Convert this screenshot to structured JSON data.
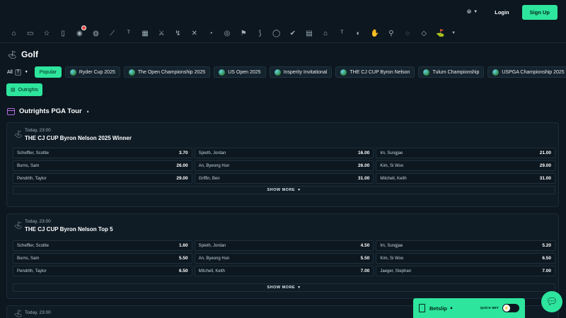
{
  "topbar": {
    "login": "Login",
    "signup": "Sign Up"
  },
  "sports_icons": [
    "⌂",
    "▭",
    "☆",
    "▯",
    "◉",
    "◍",
    "⟋",
    "ᵀ",
    "▦",
    "⚔",
    "↯",
    "✕",
    "◔",
    "◎",
    "⚑",
    "⟆",
    "◯",
    "✔",
    "▤",
    "⌂",
    "ᵀ",
    "◐",
    "✋",
    "⚲",
    "◌",
    "◇",
    "⛳"
  ],
  "page": {
    "title": "Golf"
  },
  "filters": {
    "all_label": "All",
    "popular_label": "Popular",
    "tournaments": [
      "Ryder Cup 2025",
      "The Open Championship 2025",
      "US Open 2025",
      "Insperity Invitational",
      "THE CJ CUP Byron Nelson",
      "Tulum Championship",
      "USPGA Championship 2025"
    ]
  },
  "outrights_chip": "Outrights",
  "section": {
    "title": "Outrights PGA Tour"
  },
  "cards": [
    {
      "time": "Today, 23:00",
      "event": "THE CJ CUP Byron Nelson 2025 Winner",
      "cells": [
        {
          "name": "Scheffler, Scottie",
          "odds": "3.70"
        },
        {
          "name": "Spieth, Jordan",
          "odds": "16.00"
        },
        {
          "name": "Im, Sungjae",
          "odds": "21.00"
        },
        {
          "name": "Burns, Sam",
          "odds": "26.00"
        },
        {
          "name": "An, Byeong Hun",
          "odds": "26.00"
        },
        {
          "name": "Kim, Si Woo",
          "odds": "29.00"
        },
        {
          "name": "Pendrith, Taylor",
          "odds": "29.00"
        },
        {
          "name": "Griffin, Ben",
          "odds": "31.00"
        },
        {
          "name": "Mitchell, Keith",
          "odds": "31.00"
        }
      ],
      "show_more": "SHOW MORE"
    },
    {
      "time": "Today, 23:00",
      "event": "THE CJ CUP Byron Nelson Top 5",
      "cells": [
        {
          "name": "Scheffler, Scottie",
          "odds": "1.60"
        },
        {
          "name": "Spieth, Jordan",
          "odds": "4.50"
        },
        {
          "name": "Im, Sungjae",
          "odds": "5.20"
        },
        {
          "name": "Burns, Sam",
          "odds": "5.50"
        },
        {
          "name": "An, Byeong Hun",
          "odds": "5.50"
        },
        {
          "name": "Kim, Si Woo",
          "odds": "6.50"
        },
        {
          "name": "Pendrith, Taylor",
          "odds": "6.50"
        },
        {
          "name": "Mitchell, Keith",
          "odds": "7.00"
        },
        {
          "name": "Jaeger, Stephan",
          "odds": "7.00"
        }
      ],
      "show_more": "SHOW MORE"
    },
    {
      "time": "Today, 23:00"
    }
  ],
  "betslip": {
    "label": "Betslip",
    "quick_bet": "QUICK BET"
  },
  "colors": {
    "accent": "#2ee59d",
    "background": "#0c1720",
    "card": "#0f1c26",
    "section_icon": "#b46be0"
  }
}
